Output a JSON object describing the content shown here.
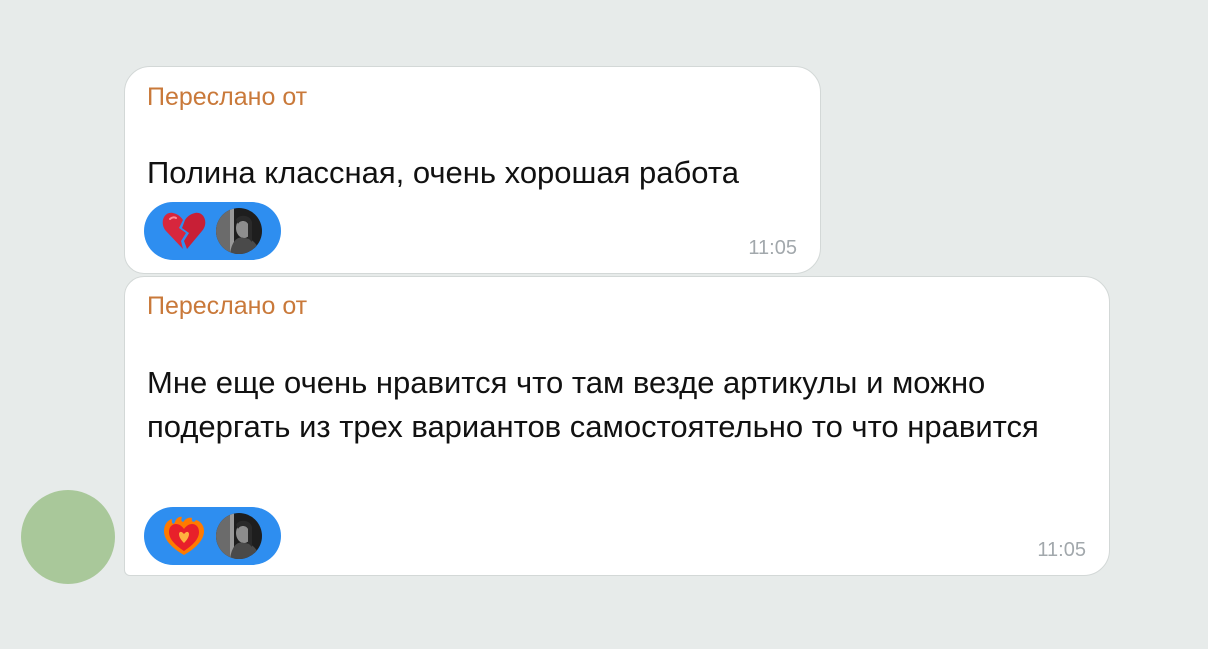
{
  "chat": {
    "messages": [
      {
        "forwarded_label": "Переслано от",
        "text": "Полина классная, очень хорошая работа",
        "reaction_emoji": "broken-heart",
        "time": "11:05"
      },
      {
        "forwarded_label": "Переслано от",
        "text": "Мне еще очень нравится что там везде артикулы и можно подергать из трех вариантов самостоятельно то что нравится",
        "reaction_emoji": "heart-on-fire",
        "time": "11:05"
      }
    ]
  },
  "colors": {
    "background": "#e7ebea",
    "forwarded_label": "#c9793a",
    "reaction_pill": "#2e8ef0",
    "sender_avatar": "#a9c89a",
    "time": "#a2a8ac"
  }
}
